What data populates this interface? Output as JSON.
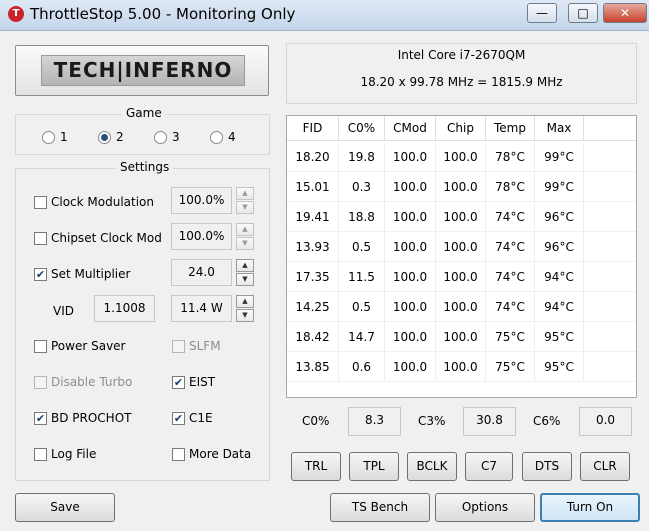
{
  "window": {
    "title": "ThrottleStop 5.00 - Monitoring Only",
    "icon_letter": "T",
    "minimize": "—",
    "maximize": "□",
    "close": "✕"
  },
  "logo": {
    "text": "TECH|INFERNO"
  },
  "cpu": {
    "name": "Intel Core i7-2670QM",
    "frequency": "18.20 x 99.78 MHz = 1815.9 MHz"
  },
  "game": {
    "label": "Game",
    "options": [
      {
        "label": "1",
        "checked": false
      },
      {
        "label": "2",
        "checked": true
      },
      {
        "label": "3",
        "checked": false
      },
      {
        "label": "4",
        "checked": false
      }
    ]
  },
  "settings": {
    "label": "Settings",
    "clock_modulation": {
      "label": "Clock Modulation",
      "checked": false,
      "value": "100.0%"
    },
    "chipset_clock_mod": {
      "label": "Chipset Clock Mod",
      "checked": false,
      "value": "100.0%"
    },
    "set_multiplier": {
      "label": "Set Multiplier",
      "checked": true,
      "value": "24.0"
    },
    "vid": {
      "label": "VID",
      "value": "1.1008",
      "watts": "11.4 W"
    },
    "power_saver": {
      "label": "Power Saver",
      "checked": false
    },
    "slfm": {
      "label": "SLFM",
      "checked": false,
      "disabled": true
    },
    "disable_turbo": {
      "label": "Disable Turbo",
      "checked": false,
      "disabled": true
    },
    "eist": {
      "label": "EIST",
      "checked": true
    },
    "bd_prochot": {
      "label": "BD PROCHOT",
      "checked": true
    },
    "c1e": {
      "label": "C1E",
      "checked": true
    },
    "log_file": {
      "label": "Log File",
      "checked": false
    },
    "more_data": {
      "label": "More Data",
      "checked": false
    }
  },
  "table": {
    "headers": [
      "FID",
      "C0%",
      "CMod",
      "Chip",
      "Temp",
      "Max"
    ],
    "rows": [
      [
        "18.20",
        "19.8",
        "100.0",
        "100.0",
        "78°C",
        "99°C"
      ],
      [
        "15.01",
        "0.3",
        "100.0",
        "100.0",
        "78°C",
        "99°C"
      ],
      [
        "19.41",
        "18.8",
        "100.0",
        "100.0",
        "74°C",
        "96°C"
      ],
      [
        "13.93",
        "0.5",
        "100.0",
        "100.0",
        "74°C",
        "96°C"
      ],
      [
        "17.35",
        "11.5",
        "100.0",
        "100.0",
        "74°C",
        "94°C"
      ],
      [
        "14.25",
        "0.5",
        "100.0",
        "100.0",
        "74°C",
        "94°C"
      ],
      [
        "18.42",
        "14.7",
        "100.0",
        "100.0",
        "75°C",
        "95°C"
      ],
      [
        "13.85",
        "0.6",
        "100.0",
        "100.0",
        "75°C",
        "95°C"
      ]
    ]
  },
  "stats": [
    {
      "label": "C0%",
      "value": "8.3"
    },
    {
      "label": "C3%",
      "value": "30.8"
    },
    {
      "label": "C6%",
      "value": "0.0"
    }
  ],
  "tool_buttons": [
    "TRL",
    "TPL",
    "BCLK",
    "C7",
    "DTS",
    "CLR"
  ],
  "bottom_buttons": {
    "save": "Save",
    "ts_bench": "TS Bench",
    "options": "Options",
    "turn_on": "Turn On"
  },
  "colors": {
    "titlebar": "#c4d5ea",
    "accent_border": "#3c7fb1",
    "close_button": "#c7432c"
  }
}
